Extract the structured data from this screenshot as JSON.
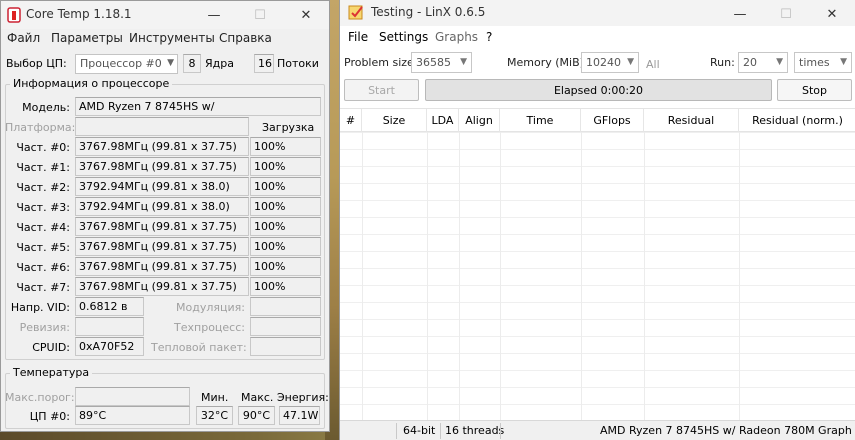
{
  "coretemp": {
    "title": "Core Temp 1.18.1",
    "menu": [
      "Файл",
      "Параметры",
      "Инструменты",
      "Справка"
    ],
    "cpu_select_label": "Выбор ЦП:",
    "cpu_select_value": "Процессор #0",
    "cores_value": "8",
    "cores_label": "Ядра",
    "threads_value": "16",
    "threads_label": "Потоки",
    "info_group_title": "Информация о процессоре",
    "model_label": "Модель:",
    "model_value": "AMD Ryzen 7 8745HS w/",
    "platform_label": "Платформа:",
    "load_header": "Загрузка",
    "freq_rows": [
      {
        "label": "Част. #0:",
        "freq": "3767.98МГц (99.81 x 37.75)",
        "load": "100%"
      },
      {
        "label": "Част. #1:",
        "freq": "3767.98МГц (99.81 x 37.75)",
        "load": "100%"
      },
      {
        "label": "Част. #2:",
        "freq": "3792.94МГц (99.81 x 38.0)",
        "load": "100%"
      },
      {
        "label": "Част. #3:",
        "freq": "3792.94МГц (99.81 x 38.0)",
        "load": "100%"
      },
      {
        "label": "Част. #4:",
        "freq": "3767.98МГц (99.81 x 37.75)",
        "load": "100%"
      },
      {
        "label": "Част. #5:",
        "freq": "3767.98МГц (99.81 x 37.75)",
        "load": "100%"
      },
      {
        "label": "Част. #6:",
        "freq": "3767.98МГц (99.81 x 37.75)",
        "load": "100%"
      },
      {
        "label": "Част. #7:",
        "freq": "3767.98МГц (99.81 x 37.75)",
        "load": "100%"
      }
    ],
    "vid_label": "Напр. VID:",
    "vid_value": "0.6812 в",
    "modulation_label": "Модуляция:",
    "revision_label": "Ревизия:",
    "process_label": "Техпроцесс:",
    "cpuid_label": "CPUID:",
    "cpuid_value": "0xA70F52",
    "tdp_label": "Тепловой пакет:",
    "temp_group_title": "Температура",
    "tjmax_label": "Макс.порог:",
    "min_header": "Мин.",
    "max_header": "Макс.",
    "power_header": "Энергия:",
    "cpu_temp_label": "ЦП #0:",
    "cpu_temp_value": "89°C",
    "min_value": "32°C",
    "max_value": "90°C",
    "power_value": "47.1W"
  },
  "linx": {
    "title": "Testing - LinX 0.6.5",
    "menu": [
      "File",
      "Settings",
      "Graphs",
      "?"
    ],
    "problem_size_label": "Problem size:",
    "problem_size_value": "36585",
    "memory_label": "Memory (MiB):",
    "memory_value": "10240",
    "all_label": "All",
    "run_label": "Run:",
    "run_value": "20",
    "times_value": "times",
    "start_label": "Start",
    "elapsed_label": "Elapsed 0:00:20",
    "stop_label": "Stop",
    "columns": [
      "#",
      "Size",
      "LDA",
      "Align",
      "Time",
      "GFlops",
      "Residual",
      "Residual (norm.)"
    ],
    "status_bits": "64-bit",
    "status_threads": "16 threads",
    "status_cpu": "AMD Ryzen 7 8745HS w/ Radeon 780M Graph"
  }
}
